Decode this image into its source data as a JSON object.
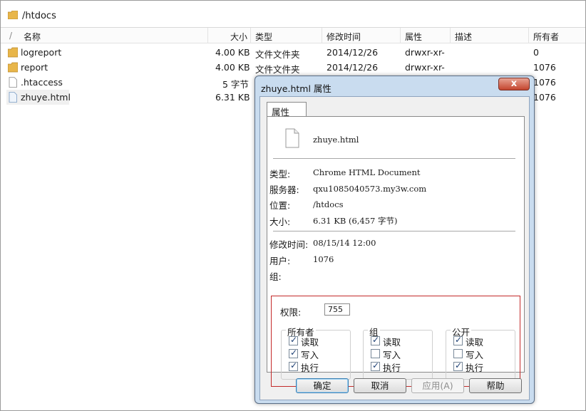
{
  "path": "/htdocs",
  "columns": {
    "sort_arrow": "/",
    "name": "名称",
    "size": "大小",
    "type": "类型",
    "modified": "修改时间",
    "attrs": "属性",
    "desc": "描述",
    "owner": "所有者"
  },
  "files": [
    {
      "icon": "folder-icon",
      "name": "logreport",
      "size": "4.00 KB",
      "type": "文件文件夹",
      "modified": "2014/12/26",
      "attrs": "drwxr-xr-",
      "owner": "0"
    },
    {
      "icon": "folder-icon",
      "name": "report",
      "size": "4.00 KB",
      "type": "文件文件夹",
      "modified": "2014/12/26",
      "attrs": "drwxr-xr-",
      "owner": "1076"
    },
    {
      "icon": "file-icon",
      "name": ".htaccess",
      "size": "5 字节",
      "type": "",
      "modified": "",
      "attrs": "",
      "owner": "1076"
    },
    {
      "icon": "html-file-icon",
      "name": "zhuye.html",
      "size": "6.31 KB",
      "type": "",
      "modified": "",
      "attrs": "",
      "owner": "1076"
    }
  ],
  "dialog": {
    "title": "zhuye.html 属性",
    "close": "x",
    "tab": "属性",
    "file_name": "zhuye.html",
    "labels": {
      "type": "类型:",
      "server": "服务器:",
      "location": "位置:",
      "size": "大小:",
      "modified": "修改时间:",
      "user": "用户:",
      "group": "组:"
    },
    "values": {
      "type": "Chrome HTML Document",
      "server": "qxu1085040573.my3w.com",
      "location": "/htdocs",
      "size": "6.31 KB (6,457 字节)",
      "modified": "08/15/14 12:00",
      "user": "1076",
      "group": ""
    },
    "perm_label": "权限:",
    "perm_value": "755",
    "groups": [
      {
        "title": "所有者",
        "items": [
          {
            "label": "读取",
            "checked": true
          },
          {
            "label": "写入",
            "checked": true
          },
          {
            "label": "执行",
            "checked": true
          }
        ]
      },
      {
        "title": "组",
        "items": [
          {
            "label": "读取",
            "checked": true
          },
          {
            "label": "写入",
            "checked": false
          },
          {
            "label": "执行",
            "checked": true
          }
        ]
      },
      {
        "title": "公开",
        "items": [
          {
            "label": "读取",
            "checked": true
          },
          {
            "label": "写入",
            "checked": false
          },
          {
            "label": "执行",
            "checked": true
          }
        ]
      }
    ],
    "buttons": {
      "ok": "确定",
      "cancel": "取消",
      "apply": "应用(A)",
      "help": "帮助"
    }
  },
  "colors": {
    "dialog_frame": "#c9dcef",
    "highlight_border": "#c32a2a",
    "folder": "#e8b64a"
  }
}
